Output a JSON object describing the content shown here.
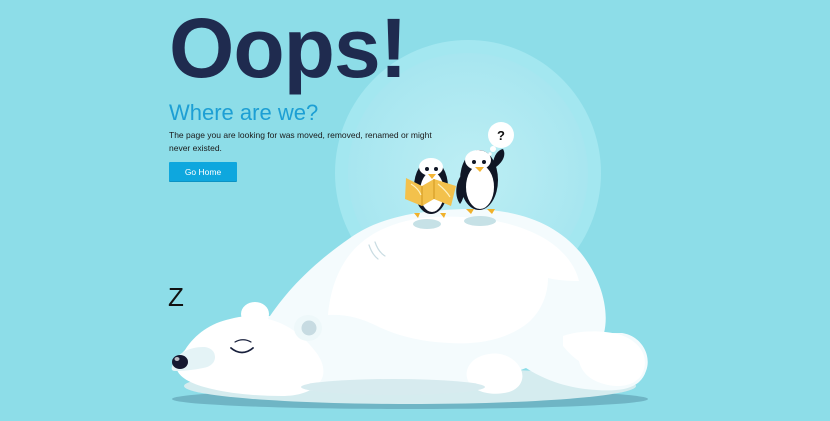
{
  "hero": {
    "title": "Oops!",
    "subtitle": "Where are we?",
    "description": "The page you are looking for was moved, removed, renamed or might never existed."
  },
  "actions": {
    "go_home_label": "Go Home"
  },
  "illustration": {
    "sleep_text": "Z",
    "thought_text": "?"
  },
  "colors": {
    "background": "#8ddde8",
    "title": "#1f2b4f",
    "subtitle": "#1d9fd4",
    "button": "#0ea7de"
  },
  "icons": {
    "bear": "polar-bear-illustration",
    "left_penguin": "reading-penguin-illustration",
    "right_penguin": "thinking-penguin-illustration",
    "moon": "moon-circle-illustration",
    "map": "map-illustration"
  }
}
